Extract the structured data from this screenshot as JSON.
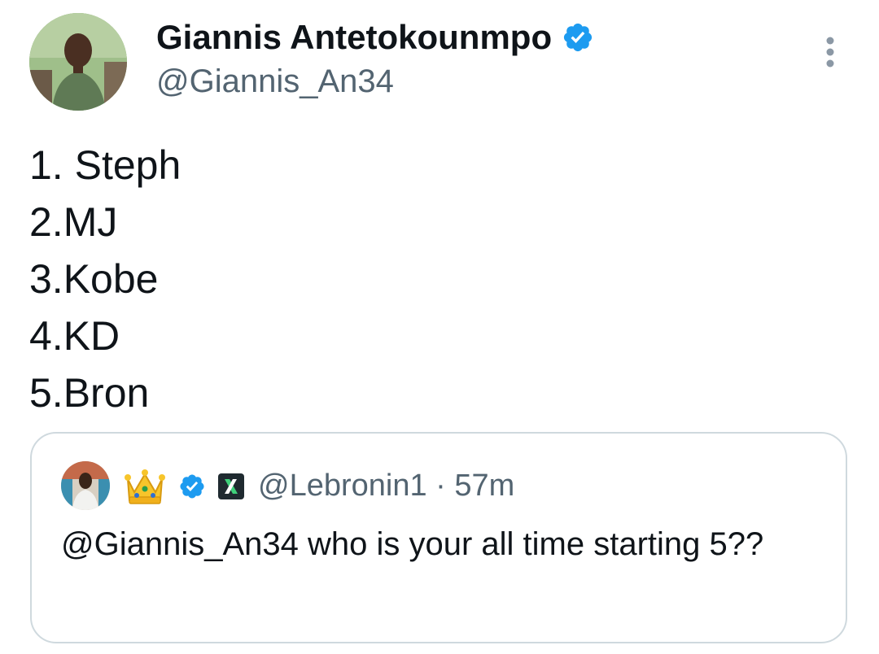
{
  "author": {
    "display_name": "Giannis Antetokounmpo",
    "handle": "@Giannis_An34",
    "verified_icon": "verified-badge-icon",
    "avatar_icon": "profile-photo"
  },
  "tweet": {
    "lines": [
      "1. Steph",
      "2.MJ",
      "3.Kobe",
      "4.KD",
      "5.Bron"
    ]
  },
  "quoted_tweet": {
    "handle_and_time": "@Lebronin1 · 57m",
    "text": "@Giannis_An34 who is your all time starting 5??",
    "badges": [
      "crown-emoji-icon",
      "verified-badge-icon",
      "affiliate-x-icon"
    ]
  },
  "colors": {
    "text_primary": "#0f1419",
    "text_secondary": "#536471",
    "verified_blue": "#1d9bf0",
    "border": "#cfd9de"
  },
  "icons": {
    "more": "more-vertical-icon"
  }
}
